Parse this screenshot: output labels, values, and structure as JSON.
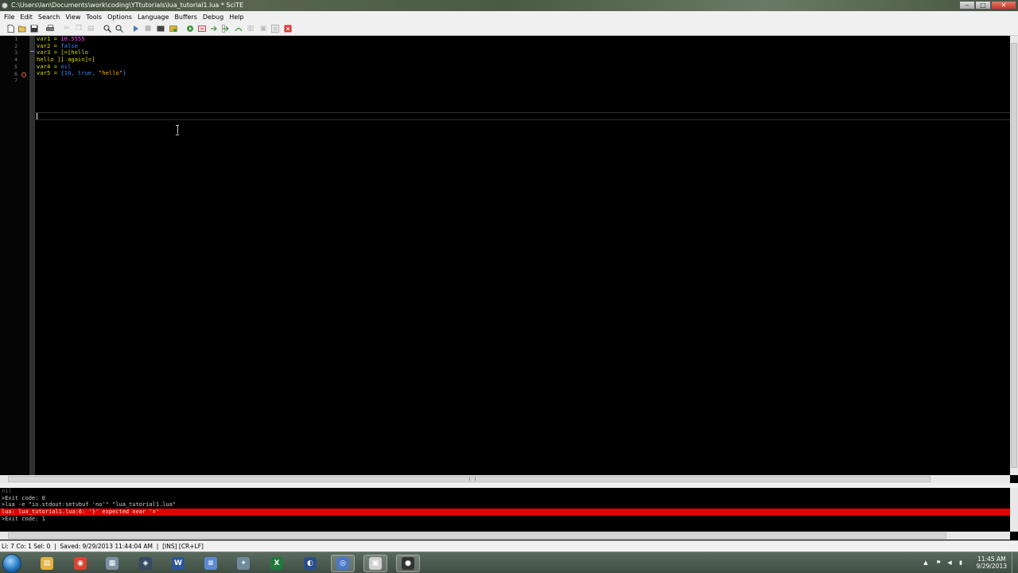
{
  "window": {
    "title": "C:\\Users\\Ian\\Documents\\work\\coding\\YTtutorials\\lua_tutorial1.lua * SciTE",
    "controls": [
      "‒",
      "□",
      "✕"
    ]
  },
  "menu": [
    "File",
    "Edit",
    "Search",
    "View",
    "Tools",
    "Options",
    "Language",
    "Buffers",
    "Debug",
    "Help"
  ],
  "toolbar": {
    "icons": [
      "new-file-icon",
      "open-file-icon",
      "save-icon",
      "print-icon",
      "cut-icon",
      "copy-icon",
      "paste-icon",
      "find-icon",
      "replace-icon",
      "compile-icon",
      "stop-icon",
      "build-icon",
      "go-icon",
      "debug-run-icon",
      "debug-step-icon",
      "debug-next-icon",
      "debug-out-icon",
      "debug-over-icon",
      "debug-watch-icon",
      "debug-break-icon",
      "debug-clear-icon",
      "debug-kill-icon"
    ]
  },
  "editor": {
    "line_numbers": [
      "1",
      "2",
      "3",
      "4",
      "5",
      "6",
      "7"
    ],
    "lines": [
      {
        "a": "var1 = ",
        "b": "10.5555"
      },
      {
        "a": "var2 = ",
        "b": "false"
      },
      {
        "a": "var3 = ",
        "b": "[=[hello"
      },
      {
        "a": "",
        "b": "hello ]] again]=]"
      },
      {
        "a": "var4 = ",
        "b": "nil"
      },
      {
        "a": "var5 = ",
        "b": "{10, true, ",
        "c": "\"hello\"",
        "d": "}"
      },
      {
        "a": "",
        "b": ""
      }
    ]
  },
  "output": {
    "lines": [
      {
        "text": "nil",
        "style": "dim"
      },
      {
        "text": ">Exit code: 0",
        "style": "normal"
      },
      {
        "text": ">lua -e \"io.stdout:setvbuf 'no'\" \"lua_tutorial1.lua\"",
        "style": "normal"
      },
      {
        "text": "lua: lua_tutorial1.lua:6: '}' expected near '='",
        "style": "err"
      },
      {
        "text": ">Exit code: 1",
        "style": "normal"
      }
    ]
  },
  "status": {
    "text": "Li: 7 Co: 1 Sel: 0  |  Saved: 9/29/2013 11:44:04 AM  |  [INS] [CR+LF]"
  },
  "taskbar": {
    "apps": [
      {
        "name": "explorer-icon",
        "glyph": "▤",
        "color": "#e3b341"
      },
      {
        "name": "chrome-icon",
        "glyph": "◉",
        "color": "#d9432f"
      },
      {
        "name": "calculator-icon",
        "glyph": "▦",
        "color": "#7d8fa3"
      },
      {
        "name": "steam-icon",
        "glyph": "◈",
        "color": "#364a63"
      },
      {
        "name": "word-icon",
        "glyph": "W",
        "color": "#2b579a"
      },
      {
        "name": "notepad-icon",
        "glyph": "≡",
        "color": "#5a8bd1"
      },
      {
        "name": "network-icon",
        "glyph": "✦",
        "color": "#6e8a9c"
      },
      {
        "name": "excel-icon",
        "glyph": "X",
        "color": "#1f7a3a"
      },
      {
        "name": "media-icon",
        "glyph": "◐",
        "color": "#2a4e8a"
      },
      {
        "name": "vpn-icon",
        "glyph": "◎",
        "color": "#4a7ac6"
      },
      {
        "name": "scite-icon",
        "glyph": "▣",
        "color": "#d0d0d0"
      },
      {
        "name": "obs-icon",
        "glyph": "●",
        "color": "#333333"
      }
    ],
    "clock_time": "11:45 AM",
    "clock_date": "9/29/2013"
  }
}
